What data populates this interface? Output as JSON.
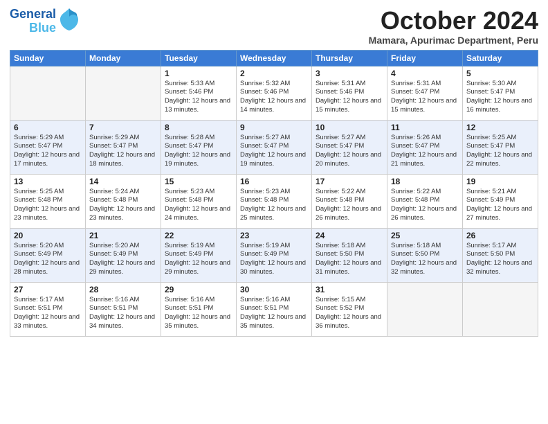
{
  "logo": {
    "line1": "General",
    "line2": "Blue"
  },
  "title": "October 2024",
  "location": "Mamara, Apurimac Department, Peru",
  "days_of_week": [
    "Sunday",
    "Monday",
    "Tuesday",
    "Wednesday",
    "Thursday",
    "Friday",
    "Saturday"
  ],
  "weeks": [
    [
      {
        "day": "",
        "empty": true
      },
      {
        "day": "",
        "empty": true
      },
      {
        "day": "1",
        "sunrise": "Sunrise: 5:33 AM",
        "sunset": "Sunset: 5:46 PM",
        "daylight": "Daylight: 12 hours and 13 minutes."
      },
      {
        "day": "2",
        "sunrise": "Sunrise: 5:32 AM",
        "sunset": "Sunset: 5:46 PM",
        "daylight": "Daylight: 12 hours and 14 minutes."
      },
      {
        "day": "3",
        "sunrise": "Sunrise: 5:31 AM",
        "sunset": "Sunset: 5:46 PM",
        "daylight": "Daylight: 12 hours and 15 minutes."
      },
      {
        "day": "4",
        "sunrise": "Sunrise: 5:31 AM",
        "sunset": "Sunset: 5:47 PM",
        "daylight": "Daylight: 12 hours and 15 minutes."
      },
      {
        "day": "5",
        "sunrise": "Sunrise: 5:30 AM",
        "sunset": "Sunset: 5:47 PM",
        "daylight": "Daylight: 12 hours and 16 minutes."
      }
    ],
    [
      {
        "day": "6",
        "sunrise": "Sunrise: 5:29 AM",
        "sunset": "Sunset: 5:47 PM",
        "daylight": "Daylight: 12 hours and 17 minutes."
      },
      {
        "day": "7",
        "sunrise": "Sunrise: 5:29 AM",
        "sunset": "Sunset: 5:47 PM",
        "daylight": "Daylight: 12 hours and 18 minutes."
      },
      {
        "day": "8",
        "sunrise": "Sunrise: 5:28 AM",
        "sunset": "Sunset: 5:47 PM",
        "daylight": "Daylight: 12 hours and 19 minutes."
      },
      {
        "day": "9",
        "sunrise": "Sunrise: 5:27 AM",
        "sunset": "Sunset: 5:47 PM",
        "daylight": "Daylight: 12 hours and 19 minutes."
      },
      {
        "day": "10",
        "sunrise": "Sunrise: 5:27 AM",
        "sunset": "Sunset: 5:47 PM",
        "daylight": "Daylight: 12 hours and 20 minutes."
      },
      {
        "day": "11",
        "sunrise": "Sunrise: 5:26 AM",
        "sunset": "Sunset: 5:47 PM",
        "daylight": "Daylight: 12 hours and 21 minutes."
      },
      {
        "day": "12",
        "sunrise": "Sunrise: 5:25 AM",
        "sunset": "Sunset: 5:47 PM",
        "daylight": "Daylight: 12 hours and 22 minutes."
      }
    ],
    [
      {
        "day": "13",
        "sunrise": "Sunrise: 5:25 AM",
        "sunset": "Sunset: 5:48 PM",
        "daylight": "Daylight: 12 hours and 23 minutes."
      },
      {
        "day": "14",
        "sunrise": "Sunrise: 5:24 AM",
        "sunset": "Sunset: 5:48 PM",
        "daylight": "Daylight: 12 hours and 23 minutes."
      },
      {
        "day": "15",
        "sunrise": "Sunrise: 5:23 AM",
        "sunset": "Sunset: 5:48 PM",
        "daylight": "Daylight: 12 hours and 24 minutes."
      },
      {
        "day": "16",
        "sunrise": "Sunrise: 5:23 AM",
        "sunset": "Sunset: 5:48 PM",
        "daylight": "Daylight: 12 hours and 25 minutes."
      },
      {
        "day": "17",
        "sunrise": "Sunrise: 5:22 AM",
        "sunset": "Sunset: 5:48 PM",
        "daylight": "Daylight: 12 hours and 26 minutes."
      },
      {
        "day": "18",
        "sunrise": "Sunrise: 5:22 AM",
        "sunset": "Sunset: 5:48 PM",
        "daylight": "Daylight: 12 hours and 26 minutes."
      },
      {
        "day": "19",
        "sunrise": "Sunrise: 5:21 AM",
        "sunset": "Sunset: 5:49 PM",
        "daylight": "Daylight: 12 hours and 27 minutes."
      }
    ],
    [
      {
        "day": "20",
        "sunrise": "Sunrise: 5:20 AM",
        "sunset": "Sunset: 5:49 PM",
        "daylight": "Daylight: 12 hours and 28 minutes."
      },
      {
        "day": "21",
        "sunrise": "Sunrise: 5:20 AM",
        "sunset": "Sunset: 5:49 PM",
        "daylight": "Daylight: 12 hours and 29 minutes."
      },
      {
        "day": "22",
        "sunrise": "Sunrise: 5:19 AM",
        "sunset": "Sunset: 5:49 PM",
        "daylight": "Daylight: 12 hours and 29 minutes."
      },
      {
        "day": "23",
        "sunrise": "Sunrise: 5:19 AM",
        "sunset": "Sunset: 5:49 PM",
        "daylight": "Daylight: 12 hours and 30 minutes."
      },
      {
        "day": "24",
        "sunrise": "Sunrise: 5:18 AM",
        "sunset": "Sunset: 5:50 PM",
        "daylight": "Daylight: 12 hours and 31 minutes."
      },
      {
        "day": "25",
        "sunrise": "Sunrise: 5:18 AM",
        "sunset": "Sunset: 5:50 PM",
        "daylight": "Daylight: 12 hours and 32 minutes."
      },
      {
        "day": "26",
        "sunrise": "Sunrise: 5:17 AM",
        "sunset": "Sunset: 5:50 PM",
        "daylight": "Daylight: 12 hours and 32 minutes."
      }
    ],
    [
      {
        "day": "27",
        "sunrise": "Sunrise: 5:17 AM",
        "sunset": "Sunset: 5:51 PM",
        "daylight": "Daylight: 12 hours and 33 minutes."
      },
      {
        "day": "28",
        "sunrise": "Sunrise: 5:16 AM",
        "sunset": "Sunset: 5:51 PM",
        "daylight": "Daylight: 12 hours and 34 minutes."
      },
      {
        "day": "29",
        "sunrise": "Sunrise: 5:16 AM",
        "sunset": "Sunset: 5:51 PM",
        "daylight": "Daylight: 12 hours and 35 minutes."
      },
      {
        "day": "30",
        "sunrise": "Sunrise: 5:16 AM",
        "sunset": "Sunset: 5:51 PM",
        "daylight": "Daylight: 12 hours and 35 minutes."
      },
      {
        "day": "31",
        "sunrise": "Sunrise: 5:15 AM",
        "sunset": "Sunset: 5:52 PM",
        "daylight": "Daylight: 12 hours and 36 minutes."
      },
      {
        "day": "",
        "empty": true
      },
      {
        "day": "",
        "empty": true
      }
    ]
  ]
}
